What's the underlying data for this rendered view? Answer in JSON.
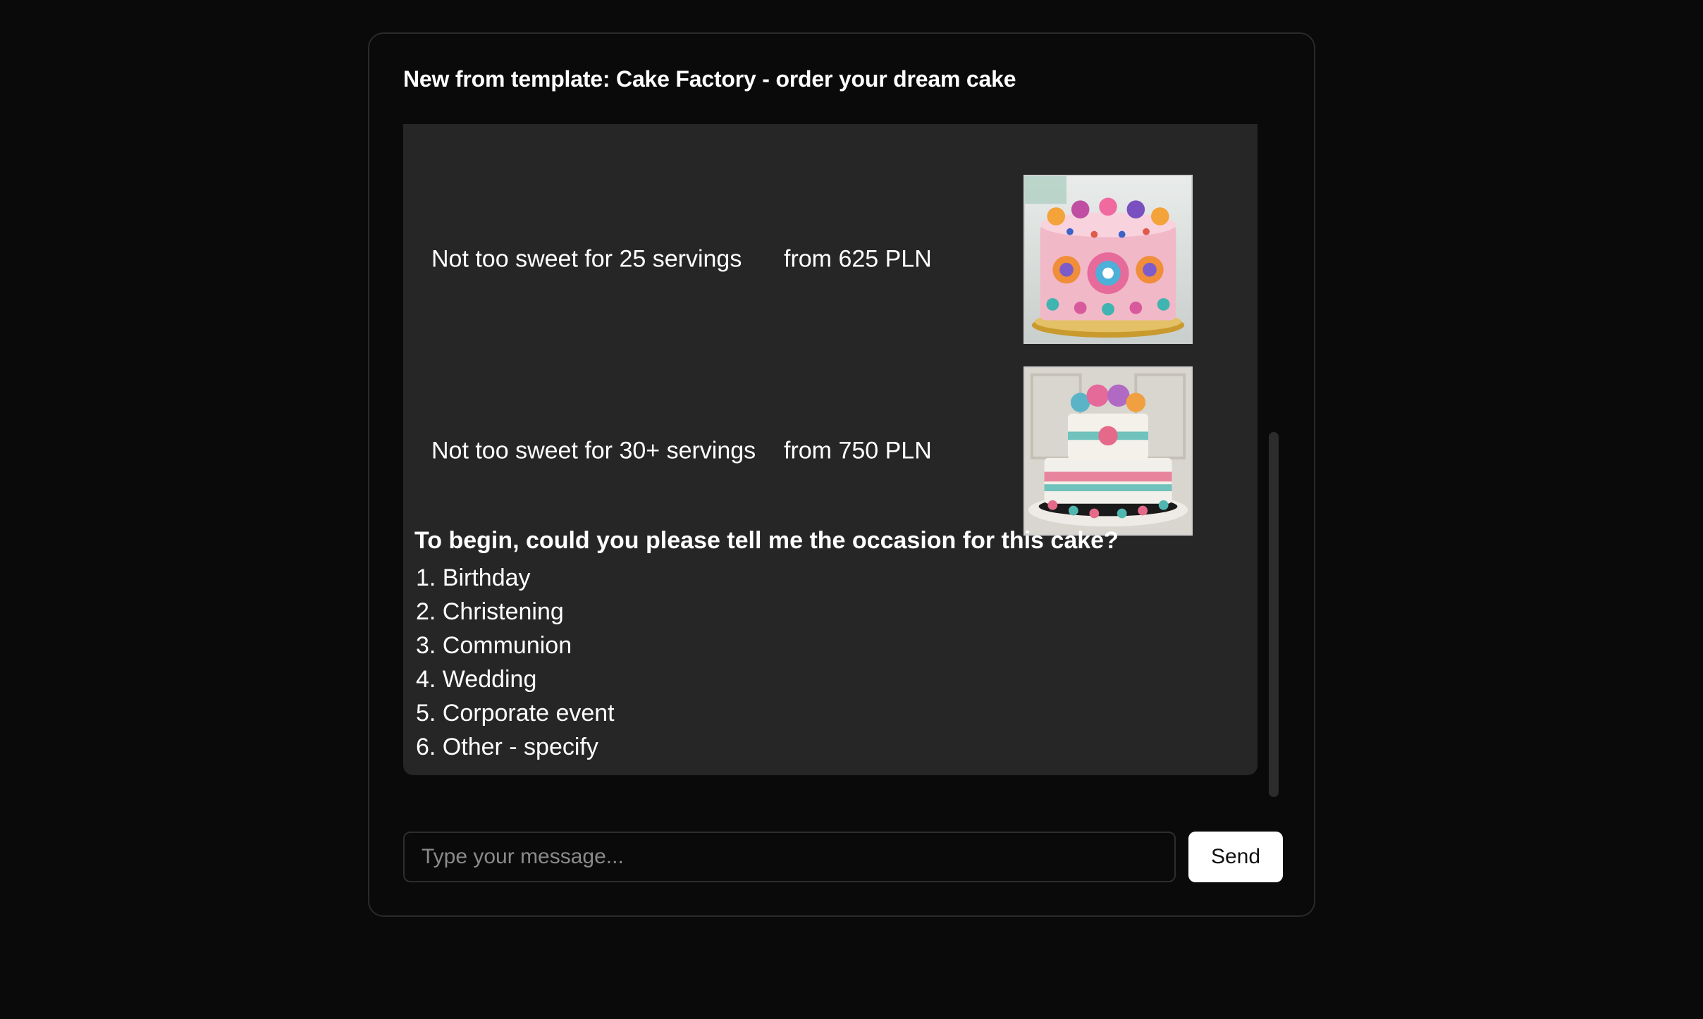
{
  "header": {
    "title": "New from template: Cake Factory - order your dream cake"
  },
  "cakes": [
    {
      "name": "Not too sweet for 25 servings",
      "price": "from 625 PLN",
      "image_icon": "single-tier-cake-image"
    },
    {
      "name": "Not too sweet for 30+ servings",
      "price": "from 750 PLN",
      "image_icon": "two-tier-cake-image"
    }
  ],
  "message": {
    "question": "To begin, could you please tell me the occasion for this cake?",
    "options": [
      "1. Birthday",
      "2. Christening",
      "3. Communion",
      "4. Wedding",
      "5. Corporate event",
      "6. Other - specify"
    ]
  },
  "composer": {
    "placeholder": "Type your message...",
    "value": "",
    "send_label": "Send"
  }
}
